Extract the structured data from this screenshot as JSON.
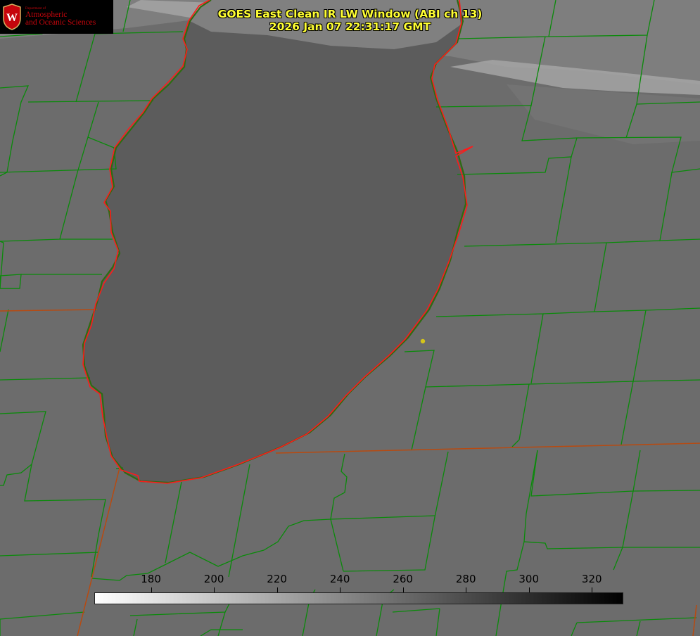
{
  "header": {
    "title_line1": "GOES East Clean IR LW Window (ABI ch 13)",
    "title_line2": "2026 Jan 07 22:31:17 GMT",
    "title_color": "#ffff33"
  },
  "logo": {
    "seal_letter": "W",
    "department": "Department of",
    "line1": "Atmospheric",
    "line2": "and Oceanic Sciences",
    "brand_color": "#c5050c"
  },
  "colorbar": {
    "ticks": [
      "180",
      "200",
      "220",
      "240",
      "260",
      "280",
      "300",
      "320"
    ],
    "tick_values": [
      180,
      200,
      220,
      240,
      260,
      280,
      300,
      320
    ],
    "range": [
      162,
      330
    ],
    "gradient": [
      "#ffffff",
      "#000000"
    ]
  },
  "map": {
    "lake_outline_color": "#ff1a1a",
    "county_line_color": "#0a8a0a",
    "state_line_color": "#b84a10",
    "marker_color": "#d4c41a"
  }
}
